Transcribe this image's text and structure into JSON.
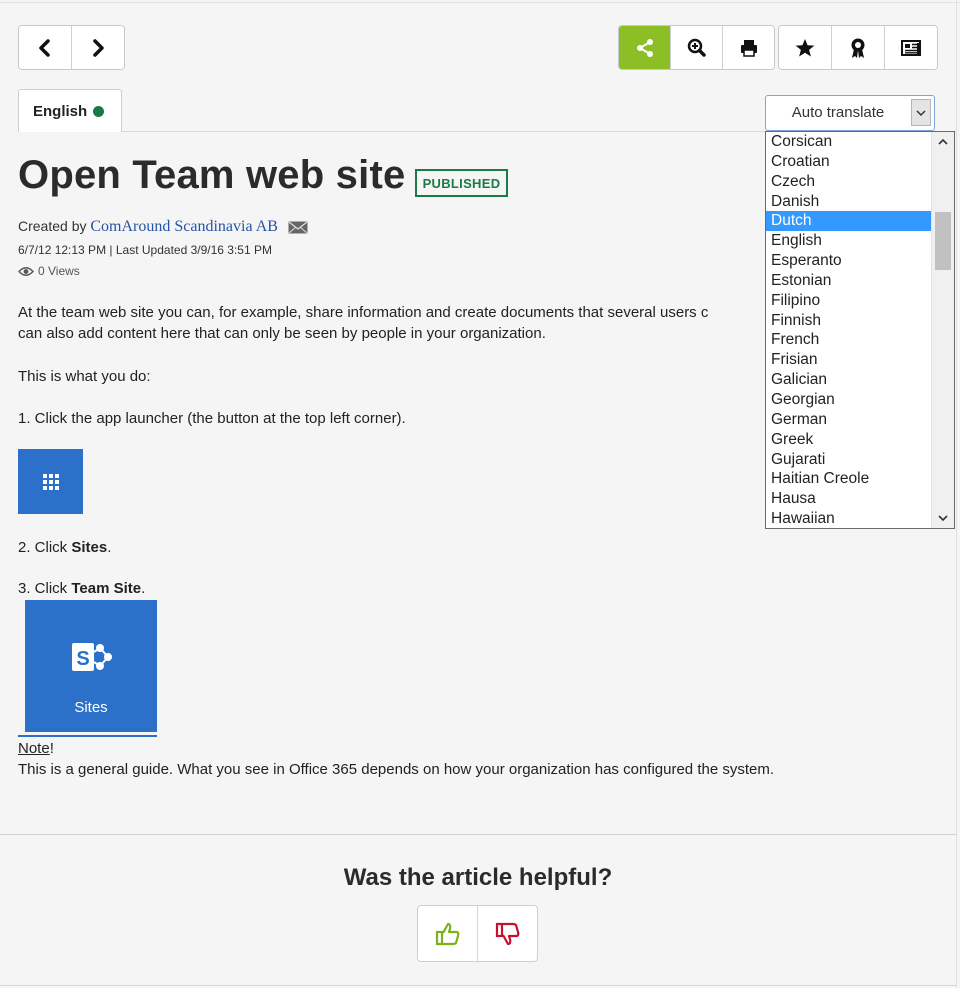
{
  "toolbar": {
    "nav": [
      {
        "name": "back",
        "icon": "chevron-left-icon"
      },
      {
        "name": "forward",
        "icon": "chevron-right-icon"
      }
    ],
    "tools": [
      {
        "name": "share",
        "icon": "share-icon"
      },
      {
        "name": "zoom",
        "icon": "zoom-in-icon"
      },
      {
        "name": "print",
        "icon": "print-icon"
      },
      {
        "name": "favorite",
        "icon": "star-icon"
      },
      {
        "name": "award",
        "icon": "award-ribbon-icon"
      },
      {
        "name": "news",
        "icon": "newspaper-icon"
      }
    ],
    "accent_color": "#8cbf26"
  },
  "language_tab": {
    "label": "English",
    "status_color": "#157a4c"
  },
  "translate": {
    "selected": "Auto translate",
    "options": [
      "Corsican",
      "Croatian",
      "Czech",
      "Danish",
      "Dutch",
      "English",
      "Esperanto",
      "Estonian",
      "Filipino",
      "Finnish",
      "French",
      "Frisian",
      "Galician",
      "Georgian",
      "German",
      "Greek",
      "Gujarati",
      "Haitian Creole",
      "Hausa",
      "Hawaiian"
    ],
    "highlighted": "Dutch"
  },
  "article": {
    "title": "Open Team web site",
    "status": "PUBLISHED",
    "created_prefix": "Created by",
    "author": "ComAround Scandinavia AB",
    "created_date": "6/7/12 12:13 PM",
    "updated": "Last Updated 3/9/16 3:51 PM",
    "views": "0 Views",
    "p1_line1": "At the team web site you can, for example, share information and create documents that several users c",
    "p1_line2": "can also add content here that can only be seen by people in your organization.",
    "p2": "This is what you do:",
    "p3": "1. Click the app launcher (the button at the top left corner).",
    "step2_prefix": "2. Click ",
    "step2_bold": "Sites",
    "step3_prefix": "3. Click ",
    "step3_bold": "Team Site",
    "tile_label": "Sites",
    "note_label": "Note",
    "note_text": "This is a general guide. What you see in Office 365 depends on how your organization has configured the system."
  },
  "feedback": {
    "question": "Was the article helpful?",
    "up_color": "#7ab317",
    "down_color": "#c8102e"
  }
}
